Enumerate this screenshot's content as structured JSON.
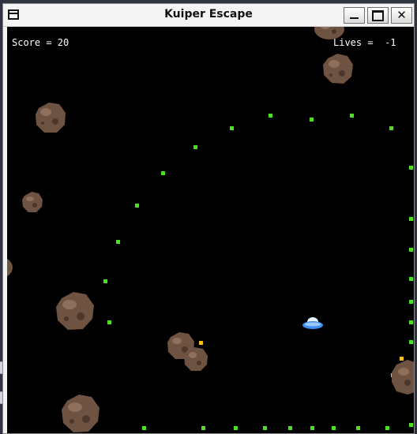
{
  "window": {
    "title": "Kuiper Escape",
    "buttons": {
      "minimize": "_",
      "maximize": "□",
      "close": "✕"
    }
  },
  "hud": {
    "score_text": "Score = 20",
    "lives_text": "Lives =  -1",
    "score": 20,
    "lives": -1
  },
  "colors": {
    "space": "#000000",
    "star": "#4be11e",
    "bonus": "#f3c21a",
    "asteroid": "#7a5a48",
    "ship": "#3d8ff0"
  },
  "icons": {
    "app": "window-icon",
    "player": "ufo-icon",
    "hazard": "asteroid-icon"
  }
}
